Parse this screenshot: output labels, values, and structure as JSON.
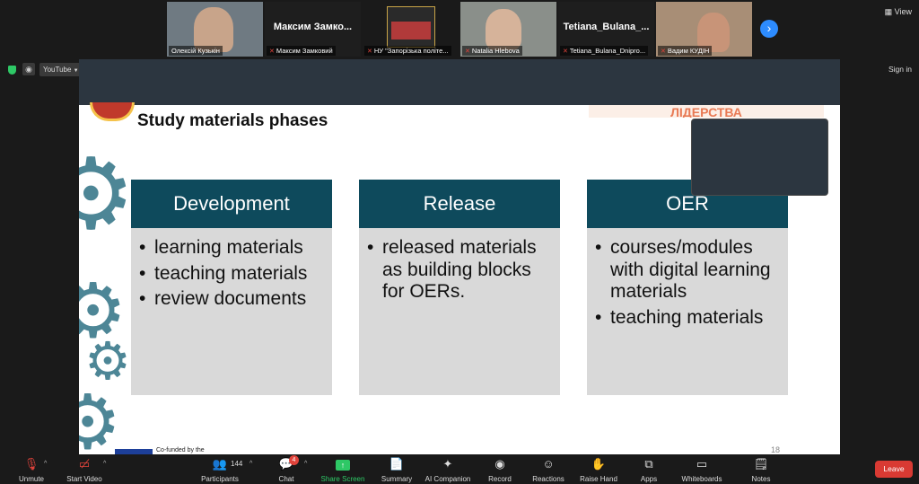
{
  "participants": [
    {
      "name": "",
      "caption": "Олексій Кузькін",
      "muted": false,
      "video": true
    },
    {
      "name": "Максим Замко...",
      "caption": "Максим Замковий",
      "muted": true,
      "video": false
    },
    {
      "name": "",
      "caption": "НУ \"Запорізька політе...",
      "muted": true,
      "video": true
    },
    {
      "name": "",
      "caption": "Natalia Hlebova",
      "muted": true,
      "video": true
    },
    {
      "name": "Tetiana_Bulana_...",
      "caption": "Tetiana_Bulana_Dnipro...",
      "muted": true,
      "video": false
    },
    {
      "name": "",
      "caption": "Вадим КУДІН",
      "muted": true,
      "video": true
    }
  ],
  "view_label": "View",
  "browser": {
    "tab_label": "YouTube",
    "signin_label": "Sign in"
  },
  "slide": {
    "title": "Study materials phases",
    "corner_text": "ЛІДЕРСТВА",
    "cofunded": "Co-funded by the",
    "page_number": "18",
    "columns": [
      {
        "heading": "Development",
        "items": [
          "learning materials",
          "teaching materials",
          "review documents"
        ]
      },
      {
        "heading": "Release",
        "items": [
          "released materials as building blocks for OERs."
        ]
      },
      {
        "heading": "OER",
        "items": [
          "courses/modules with digital learning materials",
          "teaching materials"
        ]
      }
    ]
  },
  "toolbar": {
    "unmute": "Unmute",
    "start_video": "Start Video",
    "participants": "Participants",
    "participants_count": "144",
    "chat": "Chat",
    "chat_badge": "4",
    "share_screen": "Share Screen",
    "summary": "Summary",
    "ai_companion": "AI Companion",
    "record": "Record",
    "reactions": "Reactions",
    "raise_hand": "Raise Hand",
    "apps": "Apps",
    "whiteboards": "Whiteboards",
    "notes": "Notes",
    "leave": "Leave"
  },
  "colors": {
    "accent": "#2d8cff",
    "column_header": "#0e4a5c",
    "column_body": "#d9d9d9",
    "leave": "#d93a33",
    "share_green": "#2ec866"
  }
}
